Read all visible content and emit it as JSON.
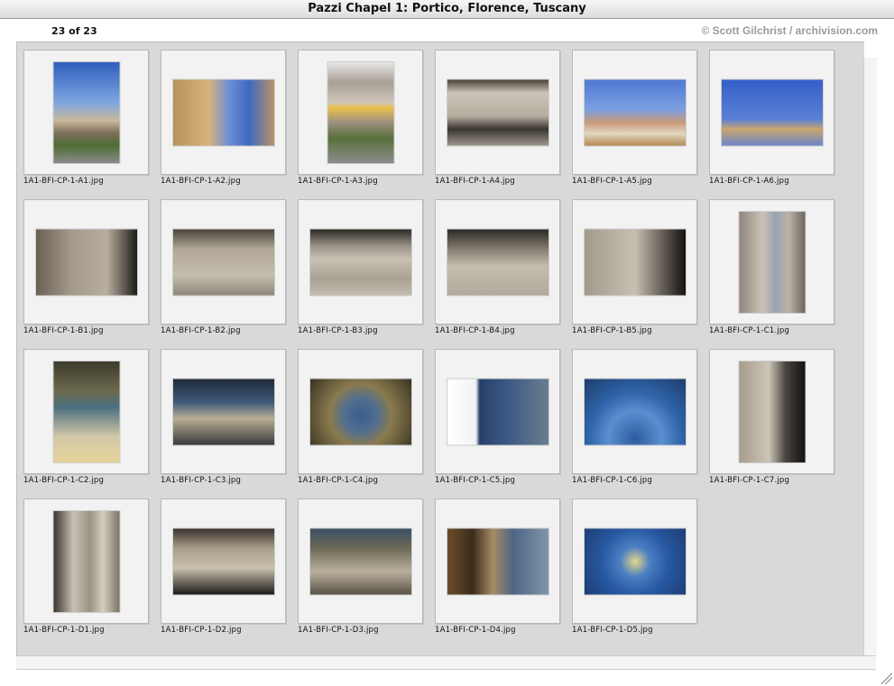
{
  "window": {
    "title": "Pazzi Chapel 1: Portico, Florence, Tuscany"
  },
  "header": {
    "counter": "23 of 23",
    "credit": "© Scott Gilchrist / archivision.com"
  },
  "colors": {
    "panel_bg": "#d9d9d9",
    "card_bg": "#f2f2f2",
    "credit_text": "#9a9a9a"
  },
  "images": [
    {
      "file": "1A1-BFI-CP-1-A1.jpg",
      "orientation": "portrait",
      "fill": "linear-gradient(#2f5fbd 0%,#7ea6df 40%,#c9b89a 58%,#7d6f5a 70%,#4f6d34 82%,#8a8a8a 100%)"
    },
    {
      "file": "1A1-BFI-CP-1-A2.jpg",
      "orientation": "landscape",
      "fill": "linear-gradient(90deg,#b7925c 0%,#d8b27c 35%,#6b8fd4 55%,#3f68c2 75%,#b89266 100%)"
    },
    {
      "file": "1A1-BFI-CP-1-A3.jpg",
      "orientation": "portrait",
      "fill": "linear-gradient(#e6e6e6 0%,#a89f94 20%,#cfc7ba 40%,#e9c14a 45%,#9b8f80 60%,#58703c 75%,#8c8c8c 100%)"
    },
    {
      "file": "1A1-BFI-CP-1-A4.jpg",
      "orientation": "landscape",
      "fill": "linear-gradient(#4a3f36 0%,#cbc4b8 20%,#b5ad9f 55%,#3a3530 75%,#9c968c 100%)"
    },
    {
      "file": "1A1-BFI-CP-1-A5.jpg",
      "orientation": "landscape",
      "fill": "linear-gradient(#4f79d2 0%,#7b9fe2 45%,#c99a7a 65%,#e1d6bf 82%,#b58a55 100%)"
    },
    {
      "file": "1A1-BFI-CP-1-A6.jpg",
      "orientation": "landscape",
      "fill": "linear-gradient(#355fc7 0%,#5b80d6 60%,#c9a670 75%,#6d84c9 100%)"
    },
    {
      "file": "1A1-BFI-CP-1-B1.jpg",
      "orientation": "landscape",
      "fill": "linear-gradient(90deg,#6a6054 0%,#a39a8c 35%,#b7ae9f 70%,#1d1b18 100%)"
    },
    {
      "file": "1A1-BFI-CP-1-B2.jpg",
      "orientation": "landscape",
      "fill": "linear-gradient(#4b433a 0%,#b1a898 30%,#c4bcae 70%,#8f877a 100%)"
    },
    {
      "file": "1A1-BFI-CP-1-B3.jpg",
      "orientation": "landscape",
      "fill": "linear-gradient(#2c2824 0%,#9a9286 25%,#c9c1b3 45%,#a9a193 75%,#c3bbad 100%)"
    },
    {
      "file": "1A1-BFI-CP-1-B4.jpg",
      "orientation": "landscape",
      "fill": "linear-gradient(#2d2925 0%,#857d71 30%,#c4bcae 55%,#b2aa9c 100%)"
    },
    {
      "file": "1A1-BFI-CP-1-B5.jpg",
      "orientation": "landscape",
      "fill": "linear-gradient(90deg,#a29a8c 0%,#c7bfb1 50%,#5a544c 80%,#151311 100%)"
    },
    {
      "file": "1A1-BFI-CP-1-C1.jpg",
      "orientation": "portrait",
      "fill": "linear-gradient(90deg,#8e877c 0%,#cbc3b6 35%,#9aa3b5 55%,#b9b2a6 75%,#6e675e 100%)"
    },
    {
      "file": "1A1-BFI-CP-1-C2.jpg",
      "orientation": "portrait",
      "fill": "linear-gradient(#3c3a2a 0%,#6d6b4e 30%,#4a6f7f 45%,#d4c9a8 75%,#e6d29a 100%)"
    },
    {
      "file": "1A1-BFI-CP-1-C3.jpg",
      "orientation": "landscape",
      "fill": "linear-gradient(#1f2b3d 0%,#3d5978 35%,#b8ae95 60%,#3a3a3a 100%)"
    },
    {
      "file": "1A1-BFI-CP-1-C4.jpg",
      "orientation": "landscape",
      "fill": "radial-gradient(circle at 50% 55%,#3a5d8c 0%,#546f8f 28%,#8a7a4e 50%,#3a3322 100%)"
    },
    {
      "file": "1A1-BFI-CP-1-C5.jpg",
      "orientation": "landscape",
      "fill": "linear-gradient(90deg,#ffffff 0%,#f2f2f2 28%,#27406a 32%,#3c5a85 60%,#6b7d8e 100%)"
    },
    {
      "file": "1A1-BFI-CP-1-C6.jpg",
      "orientation": "landscape",
      "fill": "radial-gradient(circle at 50% 90%,#2c5c9f 0%,#5a8fd0 35%,#2e64a8 60%,#1f3d6c 100%)"
    },
    {
      "file": "1A1-BFI-CP-1-C7.jpg",
      "orientation": "portrait",
      "fill": "linear-gradient(90deg,#a69c8d 0%,#cdc5b7 45%,#4a4540 70%,#111111 100%)"
    },
    {
      "file": "1A1-BFI-CP-1-D1.jpg",
      "orientation": "portrait",
      "fill": "linear-gradient(90deg,#3a3530 0%,#c8c0b2 30%,#9a9283 55%,#d5cdbf 75%,#7b7367 100%)"
    },
    {
      "file": "1A1-BFI-CP-1-D2.jpg",
      "orientation": "landscape",
      "fill": "linear-gradient(#3b342d 0%,#a89e8c 30%,#c9c0af 60%,#1c1a18 100%)"
    },
    {
      "file": "1A1-BFI-CP-1-D3.jpg",
      "orientation": "landscape",
      "fill": "linear-gradient(#3b4f66 0%,#6e6a57 30%,#b9b09d 65%,#5a5247 100%)"
    },
    {
      "file": "1A1-BFI-CP-1-D4.jpg",
      "orientation": "landscape",
      "fill": "linear-gradient(90deg,#6b4d2a 0%,#3a2b1b 25%,#a58b63 45%,#4d6585 65%,#8195a8 100%)"
    },
    {
      "file": "1A1-BFI-CP-1-D5.jpg",
      "orientation": "landscape",
      "fill": "radial-gradient(circle at 50% 50%,#e4d78a 0%,#4b7fc2 25%,#2859a3 55%,#1c3d73 100%)"
    }
  ]
}
